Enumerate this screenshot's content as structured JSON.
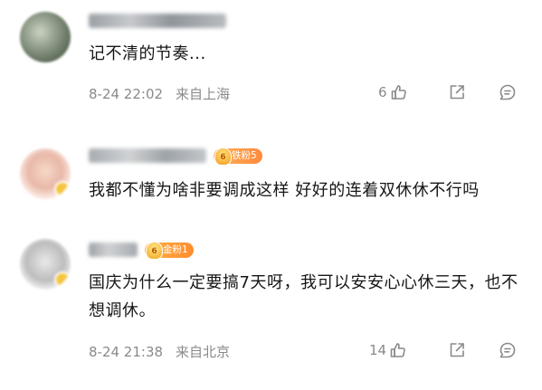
{
  "comments": [
    {
      "text": "记不清的节奏...",
      "date": "8-24 22:02",
      "location": "来自上海",
      "likes": "6",
      "fan_badge": null
    },
    {
      "text": "我都不懂为啥非要调成这样 好好的连着双休休不行吗",
      "date": null,
      "location": null,
      "likes": null,
      "fan_badge": "铁粉5"
    },
    {
      "text": "国庆为什么一定要搞7天呀，我可以安安心心休三天，也不想调休。",
      "date": "8-24 21:38",
      "location": "来自北京",
      "likes": "14",
      "fan_badge": "金粉1"
    }
  ],
  "icons": {
    "like": "thumbs-up-icon",
    "share": "share-icon",
    "comment": "comment-icon"
  },
  "colors": {
    "badge_orange": "#ff8a3c",
    "meta_gray": "#8a8a8a",
    "text": "#161616"
  }
}
